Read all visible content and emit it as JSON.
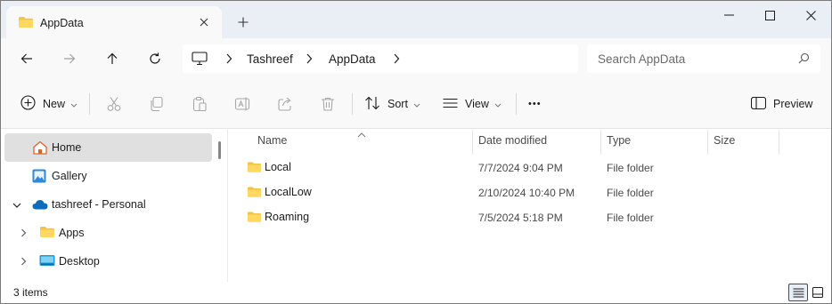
{
  "window": {
    "tab_title": "AppData",
    "new_tab_symbol": "+",
    "controls": [
      "minimize-icon",
      "maximize-icon",
      "close-icon"
    ]
  },
  "address_bar": {
    "breadcrumb": [
      "Tashreef",
      "AppData"
    ],
    "search_placeholder": "Search AppData"
  },
  "command_bar": {
    "new_label": "New",
    "sort_label": "Sort",
    "view_label": "View",
    "preview_label": "Preview",
    "more_symbol": "•••"
  },
  "navigation": {
    "items": [
      {
        "label": "Home",
        "icon": "home-icon",
        "selected": true
      },
      {
        "label": "Gallery",
        "icon": "gallery-icon"
      },
      {
        "label": "tashreef - Personal",
        "icon": "onedrive-icon",
        "expanded": true
      },
      {
        "label": "Apps",
        "icon": "folder-icon"
      },
      {
        "label": "Desktop",
        "icon": "desktop-folder-icon"
      }
    ]
  },
  "file_list": {
    "columns": [
      "Name",
      "Date modified",
      "Type",
      "Size"
    ],
    "rows": [
      {
        "name": "Local",
        "date": "7/7/2024 9:04 PM",
        "type": "File folder",
        "size": ""
      },
      {
        "name": "LocalLow",
        "date": "2/10/2024 10:40 PM",
        "type": "File folder",
        "size": ""
      },
      {
        "name": "Roaming",
        "date": "7/5/2024 5:18 PM",
        "type": "File folder",
        "size": ""
      }
    ]
  },
  "status_bar": {
    "item_count": "3 items"
  },
  "colors": {
    "folder_yellow": "#f4c542",
    "titlebar_bg": "#eaeef5",
    "selected_bg": "#e0e0e0",
    "onedrive_blue": "#0f6cbd"
  }
}
